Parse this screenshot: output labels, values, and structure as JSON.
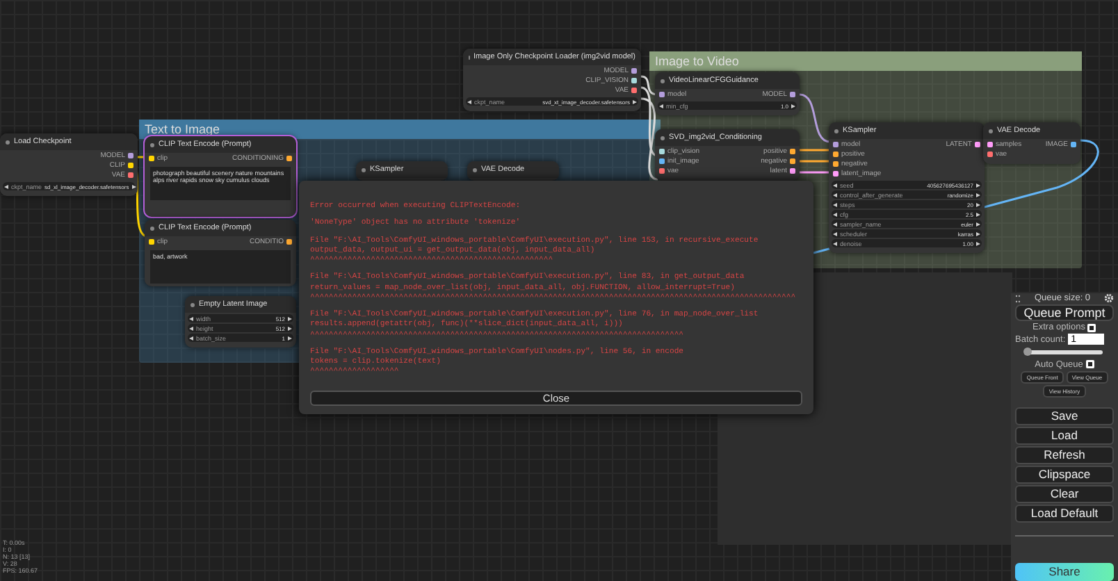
{
  "groups": [
    {
      "title": "Text to Image",
      "color": "#3f789e"
    },
    {
      "title": "Image to Video",
      "color": "#8a9f7c"
    }
  ],
  "nodes": [
    {
      "title": "Load Checkpoint",
      "selected": false,
      "outputs": [
        {
          "name": "MODEL",
          "color": "#b39ddb"
        },
        {
          "name": "CLIP",
          "color": "#ffd500"
        },
        {
          "name": "VAE",
          "color": "#ff6e6e"
        }
      ],
      "widgets": [
        {
          "name": "ckpt_name",
          "value": "sd_xl_image_decoder.safetensors"
        }
      ]
    },
    {
      "title": "Image Only Checkpoint Loader (img2vid model)",
      "selected": false,
      "outputs": [
        {
          "name": "MODEL",
          "color": "#b39ddb"
        },
        {
          "name": "CLIP_VISION",
          "color": "#a8dadc"
        },
        {
          "name": "VAE",
          "color": "#ff6e6e"
        }
      ],
      "widgets": [
        {
          "name": "ckpt_name",
          "value": "svd_xt_image_decoder.safetensors"
        }
      ]
    },
    {
      "title": "VideoLinearCFGGuidance",
      "selected": false,
      "inputs": [
        {
          "name": "model",
          "color": "#b39ddb"
        }
      ],
      "outputs": [
        {
          "name": "MODEL",
          "color": "#b39ddb"
        }
      ],
      "widgets": [
        {
          "name": "min_cfg",
          "value": "1.0"
        }
      ]
    },
    {
      "title": "SVD_img2vid_Conditioning",
      "selected": false,
      "inputs": [
        {
          "name": "clip_vision",
          "color": "#a8dadc"
        },
        {
          "name": "init_image",
          "color": "#64b5f6"
        },
        {
          "name": "vae",
          "color": "#ff6e6e"
        }
      ],
      "outputs": [
        {
          "name": "positive",
          "color": "#ffa931"
        },
        {
          "name": "negative",
          "color": "#ffa931"
        },
        {
          "name": "latent",
          "color": "#ff9cf9"
        }
      ]
    },
    {
      "title": "KSampler",
      "selected": false,
      "inputs": [
        {
          "name": "model",
          "color": "#b39ddb"
        },
        {
          "name": "positive",
          "color": "#ffa931"
        },
        {
          "name": "negative",
          "color": "#ffa931"
        },
        {
          "name": "latent_image",
          "color": "#ff9cf9"
        }
      ],
      "outputs": [
        {
          "name": "LATENT",
          "color": "#ff9cf9"
        }
      ],
      "widgets": [
        {
          "name": "seed",
          "value": "405627695436127"
        },
        {
          "name": "control_after_generate",
          "value": "randomize"
        },
        {
          "name": "steps",
          "value": "20"
        },
        {
          "name": "cfg",
          "value": "2.5"
        },
        {
          "name": "sampler_name",
          "value": "euler"
        },
        {
          "name": "scheduler",
          "value": "karras"
        },
        {
          "name": "denoise",
          "value": "1.00"
        }
      ]
    },
    {
      "title": "VAE Decode",
      "selected": false,
      "inputs": [
        {
          "name": "samples",
          "color": "#ff9cf9"
        },
        {
          "name": "vae",
          "color": "#ff6e6e"
        }
      ],
      "outputs": [
        {
          "name": "IMAGE",
          "color": "#64b5f6"
        }
      ]
    },
    {
      "title": "CLIP Text Encode (Prompt)",
      "selected": true,
      "inputs": [
        {
          "name": "clip",
          "color": "#ffd500"
        }
      ],
      "outputs": [
        {
          "name": "CONDITIONING",
          "color": "#ffa931"
        }
      ],
      "text": "photograph beautiful scenery nature mountains alps river rapids snow sky cumulus clouds"
    },
    {
      "title": "CLIP Text Encode (Prompt)",
      "selected": false,
      "inputs": [
        {
          "name": "clip",
          "color": "#ffd500"
        }
      ],
      "outputs": [
        {
          "name": "CONDITIO",
          "color": "#ffa931"
        }
      ],
      "text": "bad, artwork"
    },
    {
      "title": "Empty Latent Image",
      "selected": false,
      "widgets": [
        {
          "name": "width",
          "value": "512"
        },
        {
          "name": "height",
          "value": "512"
        },
        {
          "name": "batch_size",
          "value": "1"
        }
      ]
    },
    {
      "title": "KSampler",
      "selected": false
    },
    {
      "title": "VAE Decode",
      "selected": false
    }
  ],
  "error_dialog": {
    "paragraphs": [
      [
        "Error occurred when executing CLIPTextEncode:"
      ],
      [
        "'NoneType' object has no attribute 'tokenize'"
      ],
      [
        "File \"F:\\AI_Tools\\ComfyUI_windows_portable\\ComfyUI\\execution.py\", line 153, in recursive_execute",
        "output_data, output_ui = get_output_data(obj, input_data_all)",
        "^^^^^^^^^^^^^^^^^^^^^^^^^^^^^^^^^^^^^^^^^^^^^^^^^^^^"
      ],
      [
        "File \"F:\\AI_Tools\\ComfyUI_windows_portable\\ComfyUI\\execution.py\", line 83, in get_output_data",
        "return_values = map_node_over_list(obj, input_data_all, obj.FUNCTION, allow_interrupt=True)",
        "^^^^^^^^^^^^^^^^^^^^^^^^^^^^^^^^^^^^^^^^^^^^^^^^^^^^^^^^^^^^^^^^^^^^^^^^^^^^^^^^^^^^^^^^^^^^^^^^^^^^^^^^"
      ],
      [
        "File \"F:\\AI_Tools\\ComfyUI_windows_portable\\ComfyUI\\execution.py\", line 76, in map_node_over_list",
        "results.append(getattr(obj, func)(**slice_dict(input_data_all, i)))",
        "^^^^^^^^^^^^^^^^^^^^^^^^^^^^^^^^^^^^^^^^^^^^^^^^^^^^^^^^^^^^^^^^^^^^^^^^^^^^^^^^"
      ],
      [
        "File \"F:\\AI_Tools\\ComfyUI_windows_portable\\ComfyUI\\nodes.py\", line 56, in encode",
        "tokens = clip.tokenize(text)",
        "^^^^^^^^^^^^^^^^^^^"
      ]
    ],
    "close": "Close"
  },
  "menu": {
    "queue_size": "Queue size: 0",
    "queue_button": "Queue Prompt",
    "extra_options": {
      "label": "Extra options",
      "checked": true
    },
    "batch_count": {
      "label": "Batch count:",
      "value": "1"
    },
    "batch_slider": {
      "level": 0.0
    },
    "auto_queue": {
      "label": "Auto Queue",
      "checked": true
    },
    "small_buttons": [
      "Queue Front",
      "View Queue"
    ],
    "history_button": "View History",
    "buttons": [
      "Save",
      "Load",
      "Refresh",
      "Clipspace",
      "Clear",
      "Load Default"
    ],
    "share": "Share"
  },
  "stats": [
    "T: 0.00s",
    "I: 0",
    "N: 13 [13]",
    "V: 28",
    "FPS: 160.67"
  ]
}
